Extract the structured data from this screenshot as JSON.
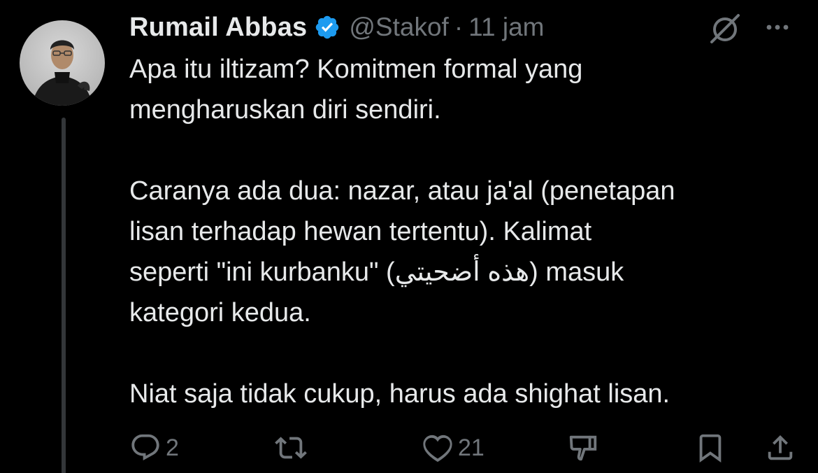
{
  "author": {
    "display_name": "Rumail Abbas",
    "handle": "@Stakof",
    "separator": "·",
    "time": "11 jam",
    "verified": true,
    "verified_color": "#1d9bf0"
  },
  "tweet": {
    "paragraphs": [
      "Apa itu iltizam? Komitmen formal yang\nmengharuskan diri sendiri.",
      "Caranya ada dua: nazar, atau ja'al (penetapan\nlisan terhadap hewan tertentu). Kalimat\nseperti \"ini kurbanku\" (هذه أضحيتي) masuk\nkategori kedua.",
      "Niat saja tidak cukup, harus ada shighat lisan."
    ]
  },
  "actions": {
    "reply_count": "2",
    "retweet_count": "",
    "like_count": "21"
  },
  "icons": {
    "grok": "grok-icon",
    "more": "more-icon",
    "reply": "reply-icon",
    "retweet": "retweet-icon",
    "like": "heart-icon",
    "dislike": "dislike-icon",
    "bookmark": "bookmark-icon",
    "share": "share-icon"
  },
  "colors": {
    "background": "#000000",
    "text": "#e7e9ea",
    "secondary": "#71767b",
    "thread_line": "#333639"
  }
}
